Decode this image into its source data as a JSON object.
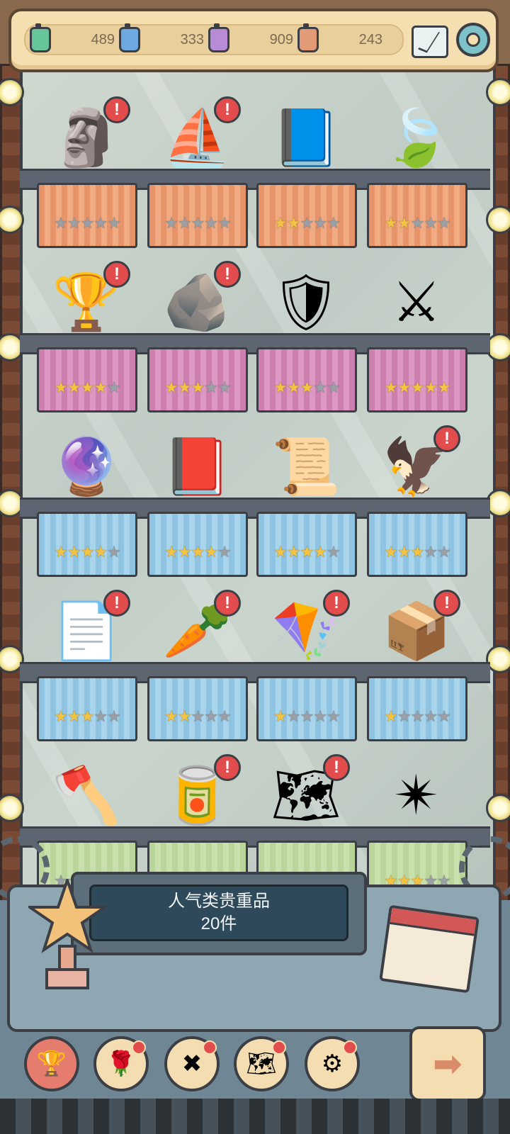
{
  "resources": [
    {
      "value": "489",
      "color": "#66c69a"
    },
    {
      "value": "333",
      "color": "#6da9e0"
    },
    {
      "value": "909",
      "color": "#b88bd7"
    },
    {
      "value": "243",
      "color": "#e39a77"
    }
  ],
  "header_icons": [
    "mail-icon",
    "gear-icon"
  ],
  "shelves": [
    {
      "cloth": "orange",
      "items": [
        {
          "icon": "stone-tablet-icon",
          "stars": 0,
          "alert": true
        },
        {
          "icon": "ship-icon",
          "stars": 0,
          "alert": true
        },
        {
          "icon": "book-eagle-icon",
          "stars": 2,
          "alert": false
        },
        {
          "icon": "leaf-icon",
          "stars": 2,
          "alert": false
        }
      ]
    },
    {
      "cloth": "pink",
      "items": [
        {
          "icon": "golden-trophy-icon",
          "stars": 4,
          "alert": true
        },
        {
          "icon": "rosetta-stone-icon",
          "stars": 3,
          "alert": true
        },
        {
          "icon": "heraldic-shield-icon",
          "stars": 3,
          "alert": false
        },
        {
          "icon": "iron-throne-icon",
          "stars": 5,
          "alert": false
        }
      ]
    },
    {
      "cloth": "blue",
      "items": [
        {
          "icon": "crystal-ball-icon",
          "stars": 4,
          "alert": false
        },
        {
          "icon": "dark-book-icon",
          "stars": 4,
          "alert": false
        },
        {
          "icon": "open-scroll-icon",
          "stars": 4,
          "alert": false
        },
        {
          "icon": "bird-tablet-icon",
          "stars": 3,
          "alert": true
        }
      ]
    },
    {
      "cloth": "blue",
      "items": [
        {
          "icon": "parchment-icon",
          "stars": 3,
          "alert": true
        },
        {
          "icon": "carrot-frame-icon",
          "stars": 2,
          "alert": true
        },
        {
          "icon": "kite-icon",
          "stars": 1,
          "alert": true
        },
        {
          "icon": "box-icon",
          "stars": 1,
          "alert": true
        }
      ]
    },
    {
      "cloth": "green",
      "items": [
        {
          "icon": "guillotine-icon",
          "stars": 0,
          "alert": false
        },
        {
          "icon": "soda-can-icon",
          "stars": 0,
          "alert": true
        },
        {
          "icon": "map-scroll-icon",
          "stars": 0,
          "alert": true
        },
        {
          "icon": "shuriken-icon",
          "stars": 3,
          "alert": false
        }
      ]
    }
  ],
  "collection_label": {
    "line1": "人气类贵重品",
    "line2": "20件"
  },
  "bottom_nav": [
    {
      "icon": "trophy-icon",
      "active": true,
      "dot": false
    },
    {
      "icon": "rose-icon",
      "active": false,
      "dot": true
    },
    {
      "icon": "crossed-tools-icon",
      "active": false,
      "dot": true
    },
    {
      "icon": "map-icon",
      "active": false,
      "dot": true
    },
    {
      "icon": "gear-icon",
      "active": false,
      "dot": true
    }
  ],
  "next_icon": "arrow-right-icon"
}
